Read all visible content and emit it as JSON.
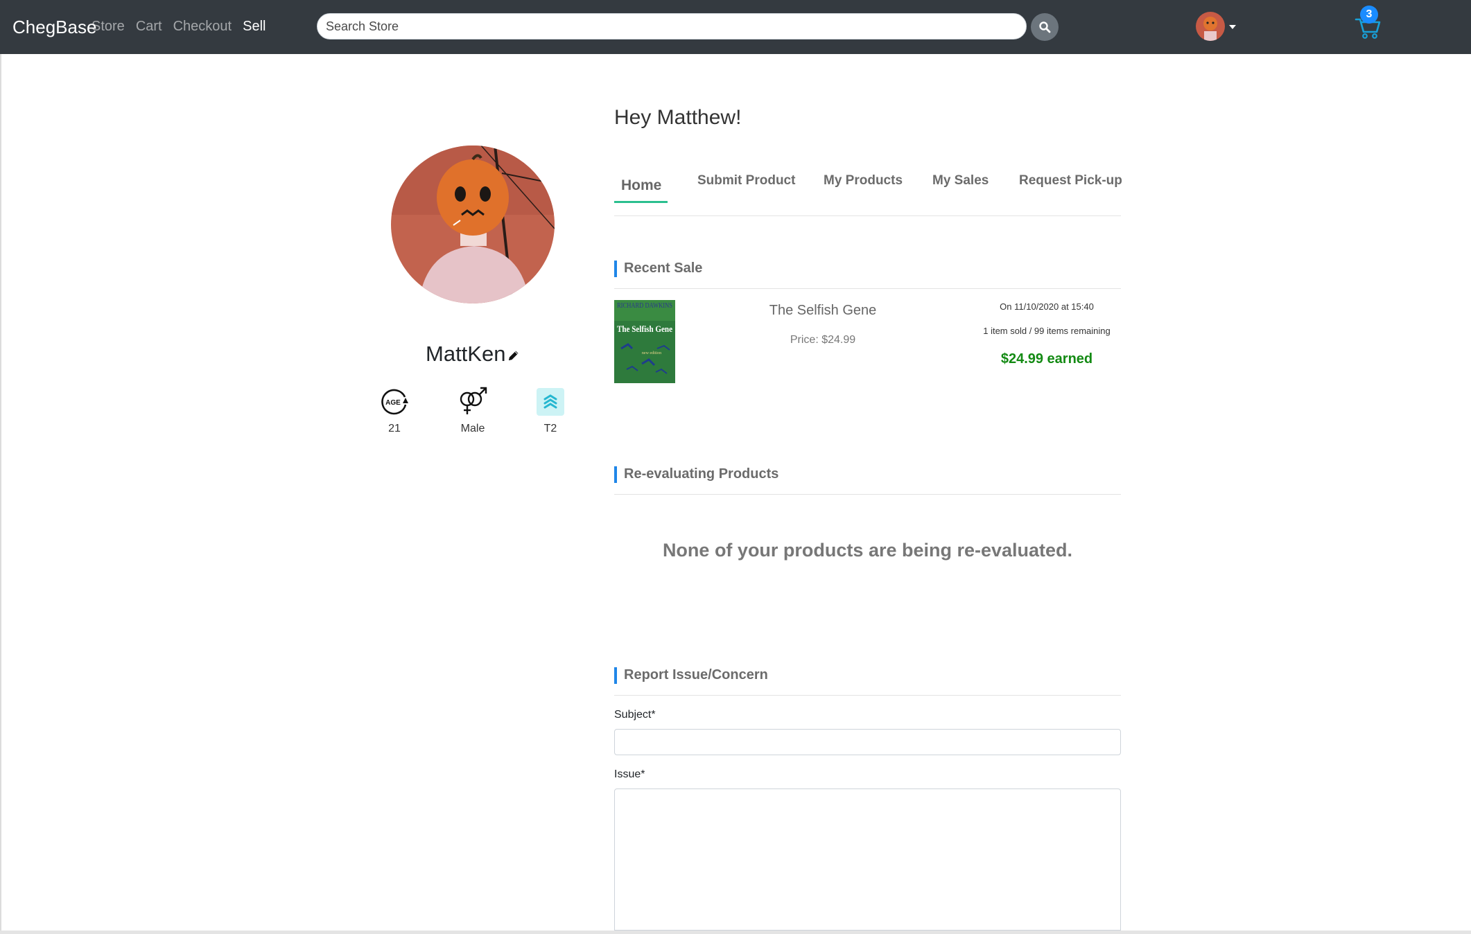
{
  "navbar": {
    "brand": "ChegBase",
    "links": [
      {
        "label": "Store",
        "active": false
      },
      {
        "label": "Cart",
        "active": false
      },
      {
        "label": "Checkout",
        "active": false
      },
      {
        "label": "Sell",
        "active": true
      }
    ],
    "search": {
      "placeholder": "Search Store",
      "value": ""
    },
    "cart_count": "3",
    "icons": [
      "search-icon",
      "avatar",
      "caret-down-icon",
      "cart-icon"
    ]
  },
  "profile": {
    "username": "MattKen",
    "stats": {
      "age": {
        "icon": "age-icon",
        "icon_text": "AGE",
        "value": "21"
      },
      "gender": {
        "icon": "gender-icon",
        "value": "Male"
      },
      "tier": {
        "icon": "tier-icon",
        "value": "T2"
      }
    }
  },
  "main": {
    "greeting": "Hey Matthew!",
    "tabs": [
      {
        "label": "Home",
        "active": true
      },
      {
        "label": "Submit Product",
        "active": false
      },
      {
        "label": "My Products",
        "active": false
      },
      {
        "label": "My Sales",
        "active": false
      },
      {
        "label": "Request Pick-up",
        "active": false
      }
    ],
    "recent_sale": {
      "heading": "Recent Sale",
      "book": {
        "cover_author": "RICHARD DAWKINS",
        "cover_title": "The Selfish Gene",
        "cover_edition": "new edition"
      },
      "title": "The Selfish Gene",
      "price": "Price: $24.99",
      "date": "On 11/10/2020 at 15:40",
      "remaining": "1 item sold / 99 items remaining",
      "earned": "$24.99 earned"
    },
    "reevaluating": {
      "heading": "Re-evaluating Products",
      "empty_message": "None of your products are being re-evaluated."
    },
    "report": {
      "heading": "Report Issue/Concern",
      "subject_label": "Subject*",
      "subject_value": "",
      "issue_label": "Issue*",
      "issue_value": ""
    }
  },
  "colors": {
    "navbar_bg": "#343a40",
    "accent_blue": "#1f86e8",
    "tab_underline": "#2bbf8f",
    "earned_green": "#138a13",
    "badge_blue": "#1a8cff"
  }
}
